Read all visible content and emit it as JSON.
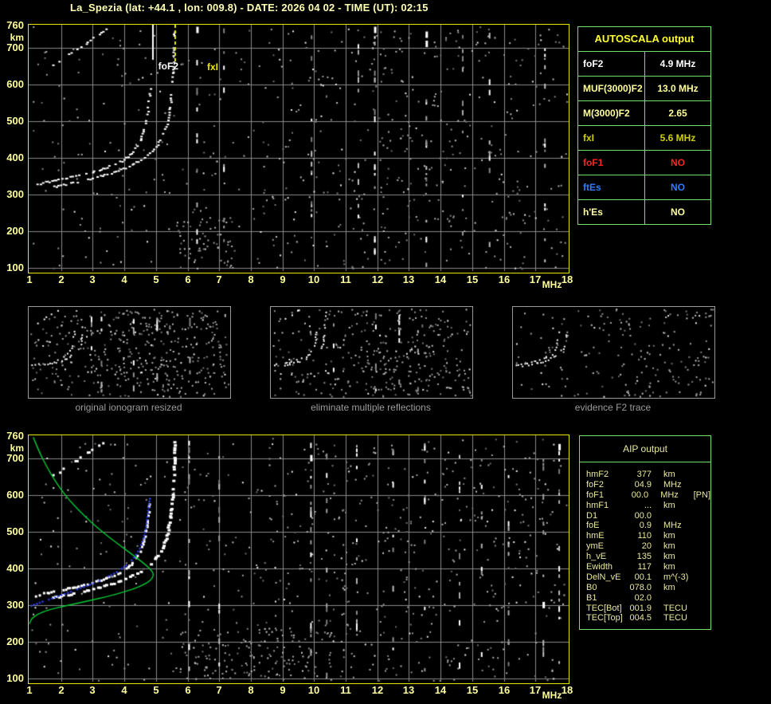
{
  "title": "La_Spezia (lat: +44.1 , lon: 009.8) - DATE: 2026 04 02 - TIME (UT): 02:15",
  "colors": {
    "background": "#000000",
    "plot_border": "#e6e600",
    "grid": "#8a8a8a",
    "axis_text": "#ffff9e",
    "title_text": "#ffffb4",
    "table_border": "#70e070",
    "autoscala_header": "#ffff33",
    "aip_text": "#e8e89e",
    "caption_text": "#9c9c9c",
    "trace_white": "#ffffff",
    "profile_green": "#00cc33",
    "fit_blue": "#3344ff",
    "fof2_line": "#ffffff",
    "fxi_line": "#e8e800",
    "alert_red": "#ff2222",
    "alert_blue": "#2f7cff",
    "pale_yellow": "#ffff9c",
    "dark_yellow": "#cfcf00"
  },
  "axes": {
    "x_range": [
      1,
      18
    ],
    "y_range": [
      100,
      760
    ],
    "x_ticks": [
      1,
      2,
      3,
      4,
      5,
      6,
      7,
      8,
      9,
      10,
      11,
      12,
      13,
      14,
      15,
      16,
      17,
      18
    ],
    "y_ticks": [
      760,
      700,
      600,
      500,
      400,
      300,
      200,
      100
    ],
    "x_unit": "MHz",
    "y_unit": "km"
  },
  "ionogram_traces": {
    "o_mode": [
      [
        1.15,
        328
      ],
      [
        1.6,
        337
      ],
      [
        2.1,
        346
      ],
      [
        2.6,
        355
      ],
      [
        3.1,
        366
      ],
      [
        3.5,
        378
      ],
      [
        3.9,
        393
      ],
      [
        4.2,
        413
      ],
      [
        4.45,
        443
      ],
      [
        4.6,
        478
      ],
      [
        4.7,
        520
      ],
      [
        4.76,
        562
      ],
      [
        4.8,
        602
      ]
    ],
    "x_mode": [
      [
        1.65,
        321
      ],
      [
        2.2,
        331
      ],
      [
        2.7,
        340
      ],
      [
        3.2,
        351
      ],
      [
        3.7,
        364
      ],
      [
        4.15,
        379
      ],
      [
        4.55,
        398
      ],
      [
        4.9,
        423
      ],
      [
        5.15,
        453
      ],
      [
        5.32,
        492
      ],
      [
        5.42,
        540
      ],
      [
        5.48,
        598
      ],
      [
        5.52,
        656
      ],
      [
        5.55,
        712
      ],
      [
        5.56,
        752
      ]
    ],
    "second_hop": [
      [
        1.68,
        651
      ],
      [
        2.0,
        669
      ],
      [
        2.35,
        690
      ],
      [
        2.7,
        710
      ],
      [
        3.05,
        731
      ],
      [
        3.35,
        748
      ],
      [
        3.55,
        757
      ]
    ]
  },
  "top_plot": {
    "seed": 20260402,
    "speckles": 620,
    "cluster": {
      "f": [
        5.65,
        7.5
      ],
      "km": [
        100,
        240
      ],
      "n": 55
    },
    "columns": [
      {
        "f": 6.3,
        "n": 10
      },
      {
        "f": 7.15,
        "n": 9
      },
      {
        "f": 9.92,
        "n": 14
      },
      {
        "f": 11.4,
        "n": 10
      },
      {
        "f": 11.92,
        "n": 16
      },
      {
        "f": 13.55,
        "n": 12
      },
      {
        "f": 14.7,
        "n": 9
      },
      {
        "f": 15.55,
        "n": 8
      },
      {
        "f": 17.3,
        "n": 12
      }
    ],
    "blobs": [
      {
        "f": 13.55,
        "km": 735
      },
      {
        "f": 13.55,
        "km": 710
      },
      {
        "f": 11.92,
        "km": 748
      },
      {
        "f": 6.3,
        "km": 748
      }
    ],
    "markers": {
      "foF2": {
        "label": "foF2",
        "freq_mhz": 4.9
      },
      "fxI": {
        "label": "fxI",
        "freq_mhz": 5.6
      }
    }
  },
  "autoscala": {
    "title": "AUTOSCALA output",
    "rows": [
      {
        "label": "foF2",
        "value": "4.9 MHz",
        "label_color": "#ffffff",
        "value_color": "#ffffff"
      },
      {
        "label": "MUF(3000)F2",
        "value": "13.0 MHz",
        "label_color": "#ffff9c",
        "value_color": "#ffff9c"
      },
      {
        "label": "M(3000)F2",
        "value": "2.65",
        "label_color": "#ffff9c",
        "value_color": "#ffff9c"
      },
      {
        "label": "fxI",
        "value": "5.6 MHz",
        "label_color": "#cfcf00",
        "value_color": "#cfcf00"
      },
      {
        "label": "foF1",
        "value": "NO",
        "label_color": "#ff2222",
        "value_color": "#ff2222"
      },
      {
        "label": "ftEs",
        "value": "NO",
        "label_color": "#2f7cff",
        "value_color": "#2f7cff"
      },
      {
        "label": "h'Es",
        "value": "NO",
        "label_color": "#ffff9c",
        "value_color": "#ffff9c"
      }
    ]
  },
  "thumbnails": [
    {
      "caption": "original ionogram resized",
      "seed": 101,
      "speckles": 430
    },
    {
      "caption": "eliminate multiple reflections",
      "seed": 202,
      "speckles": 360
    },
    {
      "caption": "evidence F2 trace",
      "seed": 303,
      "speckles": 200
    }
  ],
  "bottom_plot": {
    "seed": 4253,
    "speckles": 680,
    "cluster": {
      "f": [
        5.7,
        10.6
      ],
      "km": [
        100,
        240
      ],
      "n": 130
    },
    "columns": [
      {
        "f": 6.05,
        "n": 12
      },
      {
        "f": 7.0,
        "n": 10
      },
      {
        "f": 9.9,
        "n": 16
      },
      {
        "f": 10.4,
        "n": 9
      },
      {
        "f": 11.35,
        "n": 12
      },
      {
        "f": 12.5,
        "n": 8
      },
      {
        "f": 13.5,
        "n": 10
      },
      {
        "f": 14.6,
        "n": 9
      },
      {
        "f": 15.3,
        "n": 8
      },
      {
        "f": 16.15,
        "n": 10
      },
      {
        "f": 17.25,
        "n": 12
      },
      {
        "f": 17.75,
        "n": 14
      }
    ],
    "blobs": [
      {
        "f": 9.9,
        "km": 700
      },
      {
        "f": 17.75,
        "km": 730
      },
      {
        "f": 17.25,
        "km": 300
      }
    ],
    "profile_green": [
      [
        1.12,
        757
      ],
      [
        1.3,
        718
      ],
      [
        1.55,
        676
      ],
      [
        1.85,
        632
      ],
      [
        2.25,
        586
      ],
      [
        2.75,
        541
      ],
      [
        3.3,
        499
      ],
      [
        3.85,
        463
      ],
      [
        4.35,
        431
      ],
      [
        4.7,
        408
      ],
      [
        4.88,
        392
      ],
      [
        4.93,
        381
      ],
      [
        4.82,
        366
      ],
      [
        4.52,
        351
      ],
      [
        4.05,
        337
      ],
      [
        3.45,
        323
      ],
      [
        2.8,
        310
      ],
      [
        2.15,
        298
      ],
      [
        1.6,
        287
      ],
      [
        1.25,
        275
      ],
      [
        1.05,
        262
      ],
      [
        1.0,
        248
      ]
    ],
    "fit_blue": [
      [
        1.05,
        299
      ],
      [
        1.4,
        310
      ],
      [
        1.8,
        322
      ],
      [
        2.2,
        334
      ],
      [
        2.6,
        347
      ],
      [
        3.0,
        360
      ],
      [
        3.4,
        375
      ],
      [
        3.75,
        391
      ],
      [
        4.05,
        409
      ],
      [
        4.3,
        430
      ],
      [
        4.48,
        455
      ],
      [
        4.6,
        483
      ],
      [
        4.68,
        515
      ],
      [
        4.73,
        550
      ],
      [
        4.78,
        583
      ],
      [
        4.83,
        606
      ]
    ]
  },
  "aip": {
    "title": "AIP output",
    "rows": [
      {
        "name": "hmF2",
        "value": "377",
        "unit": "km",
        "extra": ""
      },
      {
        "name": "foF2",
        "value": "04.9",
        "unit": "MHz",
        "extra": ""
      },
      {
        "name": "foF1",
        "value": "00.0",
        "unit": "MHz",
        "extra": "[PN]"
      },
      {
        "name": "hmF1",
        "value": "...",
        "unit": "km",
        "extra": ""
      },
      {
        "name": "D1",
        "value": "00.0",
        "unit": "",
        "extra": ""
      },
      {
        "name": "foE",
        "value": "0.9",
        "unit": "MHz",
        "extra": ""
      },
      {
        "name": "hmE",
        "value": "110",
        "unit": "km",
        "extra": ""
      },
      {
        "name": "ymE",
        "value": "20",
        "unit": "km",
        "extra": ""
      },
      {
        "name": "h_vE",
        "value": "135",
        "unit": "km",
        "extra": ""
      },
      {
        "name": "Ewidth",
        "value": "117",
        "unit": "km",
        "extra": ""
      },
      {
        "name": "DelN_vE",
        "value": "00.1",
        "unit": "m^(-3)",
        "extra": ""
      },
      {
        "name": "B0",
        "value": "078.0",
        "unit": "km",
        "extra": ""
      },
      {
        "name": "B1",
        "value": "02.0",
        "unit": "",
        "extra": ""
      },
      {
        "name": "TEC[Bot]",
        "value": "001.9",
        "unit": "TECU",
        "extra": ""
      },
      {
        "name": "TEC[Top]",
        "value": "004.5",
        "unit": "TECU",
        "extra": ""
      }
    ]
  }
}
